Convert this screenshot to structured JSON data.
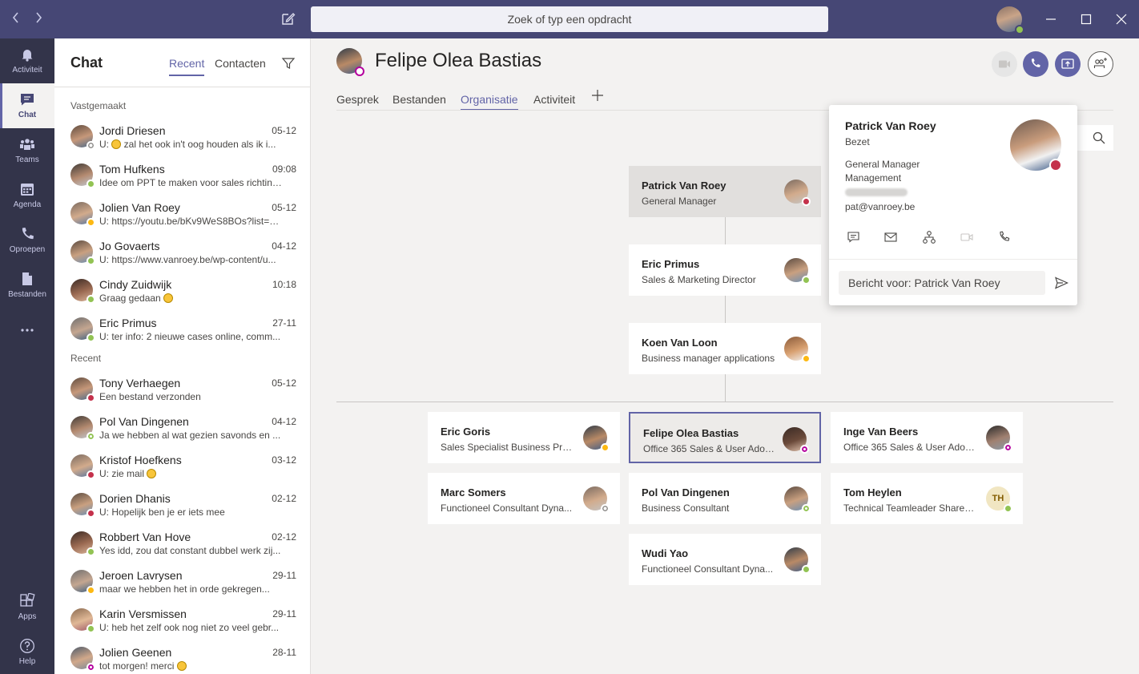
{
  "titlebar": {
    "back_icon": "chevron-left-icon",
    "forward_icon": "chevron-right-icon",
    "search_placeholder": "Zoek of typ een opdracht"
  },
  "rail": {
    "items": [
      {
        "label": "Activiteit",
        "icon": "bell-icon"
      },
      {
        "label": "Chat",
        "icon": "chat-icon"
      },
      {
        "label": "Teams",
        "icon": "teams-icon"
      },
      {
        "label": "Agenda",
        "icon": "calendar-icon"
      },
      {
        "label": "Oproepen",
        "icon": "phone-icon"
      },
      {
        "label": "Bestanden",
        "icon": "file-icon"
      },
      {
        "label": "",
        "icon": "more-icon"
      },
      {
        "label": "Apps",
        "icon": "apps-icon"
      },
      {
        "label": "Help",
        "icon": "help-icon"
      }
    ]
  },
  "chatlist": {
    "title": "Chat",
    "tabs": [
      "Recent",
      "Contacten"
    ],
    "pinned_header": "Vastgemaakt",
    "recent_header": "Recent",
    "pinned": [
      {
        "name": "Jordi Driesen",
        "time": "05-12",
        "preview": "U: ",
        "preview_rest": " zal het ook in't oog houden als ik i...",
        "status": "grey"
      },
      {
        "name": "Tom Hufkens",
        "time": "09:08",
        "preview": "Idee om PPT te maken voor sales richting...",
        "status": "green"
      },
      {
        "name": "Jolien Van Roey",
        "time": "05-12",
        "preview": "U: https://youtu.be/bKv9WeS8BOs?list=P...",
        "status": "yellow"
      },
      {
        "name": "Jo Govaerts",
        "time": "04-12",
        "preview": "U: https://www.vanroey.be/wp-content/u...",
        "status": "green"
      },
      {
        "name": "Cindy Zuidwijk",
        "time": "10:18",
        "preview": "Graag gedaan ",
        "status": "green"
      },
      {
        "name": "Eric Primus",
        "time": "27-11",
        "preview": "U: ter info: 2 nieuwe cases online, comm...",
        "status": "green"
      }
    ],
    "recent": [
      {
        "name": "Tony Verhaegen",
        "time": "05-12",
        "preview": "Een bestand verzonden",
        "status": "red"
      },
      {
        "name": "Pol Van Dingenen",
        "time": "04-12",
        "preview": "Ja we hebben al wat gezien savonds en ...",
        "status": "greenring"
      },
      {
        "name": "Kristof Hoefkens",
        "time": "03-12",
        "preview": "U: zie mail ",
        "status": "red"
      },
      {
        "name": "Dorien Dhanis",
        "time": "02-12",
        "preview": "U: Hopelijk ben je er iets mee",
        "status": "red"
      },
      {
        "name": "Robbert Van Hove",
        "time": "02-12",
        "preview": "Yes idd, zou dat constant dubbel werk zij...",
        "status": "green"
      },
      {
        "name": "Jeroen Lavrysen",
        "time": "29-11",
        "preview": "maar we hebben het in orde gekregen...",
        "status": "yellow"
      },
      {
        "name": "Karin Versmissen",
        "time": "29-11",
        "preview": "U: heb het zelf ook nog niet zo veel gebr...",
        "status": "green"
      },
      {
        "name": "Jolien Geenen",
        "time": "28-11",
        "preview": "tot morgen! merci ",
        "status": "purple"
      }
    ]
  },
  "main": {
    "title": "Felipe Olea Bastias",
    "tabs": [
      "Gesprek",
      "Bestanden",
      "Organisatie",
      "Activiteit"
    ],
    "active_tab": "Organisatie"
  },
  "orgchart": {
    "chain": [
      {
        "name": "Patrick Van Roey",
        "title": "General Manager",
        "status": "red"
      },
      {
        "name": "Eric Primus",
        "title": "Sales & Marketing Director",
        "status": "green"
      },
      {
        "name": "Koen Van Loon",
        "title": "Business manager applications",
        "status": "yellow"
      }
    ],
    "peers": [
      {
        "name": "Eric Goris",
        "title": "Sales Specialist Business Proc...",
        "status": "yellow"
      },
      {
        "name": "Felipe Olea Bastias",
        "title": "Office 365 Sales & User Adop...",
        "status": "purple",
        "selected": true
      },
      {
        "name": "Inge Van Beers",
        "title": "Office 365 Sales & User Adop...",
        "status": "purple"
      },
      {
        "name": "Marc Somers",
        "title": "Functioneel Consultant Dyna...",
        "status": "grey"
      },
      {
        "name": "Pol Van Dingenen",
        "title": "Business Consultant",
        "status": "greenring"
      },
      {
        "name": "Tom Heylen",
        "title": "Technical Teamleader Sharepo...",
        "status": "green",
        "initials": "TH"
      },
      {
        "name": "Wudi Yao",
        "title": "Functioneel Consultant Dyna...",
        "status": "green"
      }
    ]
  },
  "popup": {
    "name": "Patrick Van Roey",
    "status": "Bezet",
    "job_title": "General Manager",
    "department": "Management",
    "email": "pat@vanroey.be",
    "message_placeholder": "Bericht voor: Patrick Van Roey"
  },
  "colors": {
    "accent": "#6264a7",
    "titlebar": "#464775",
    "rail": "#33344a",
    "available": "#92c353",
    "busy": "#c4314b",
    "away": "#fdb913"
  }
}
